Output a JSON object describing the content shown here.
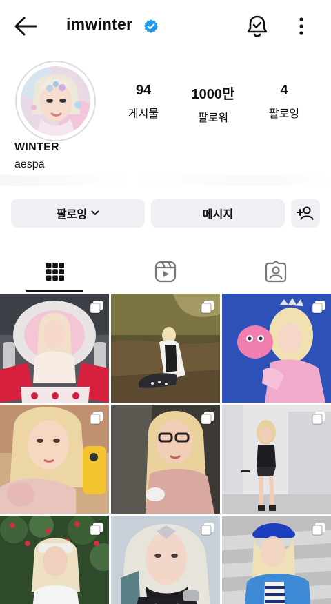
{
  "header": {
    "username": "imwinter",
    "back_icon": "arrow-left-icon",
    "verified_icon": "verified-badge-icon",
    "verified_color": "#1d9bf0",
    "bell_icon": "bell-check-icon",
    "more_icon": "more-vertical-icon"
  },
  "profile": {
    "display_name": "WINTER",
    "bio": "aespa",
    "stats": [
      {
        "value": "94",
        "label": "게시물"
      },
      {
        "value": "1000만",
        "label": "팔로워"
      },
      {
        "value": "4",
        "label": "팔로잉"
      }
    ]
  },
  "actions": {
    "following_label": "팔로잉",
    "message_label": "메시지",
    "add_icon": "add-person-icon",
    "chevron_icon": "chevron-down-icon"
  },
  "tabs": [
    {
      "name": "grid",
      "icon": "grid-icon",
      "active": true
    },
    {
      "name": "reels",
      "icon": "reels-icon",
      "active": false
    },
    {
      "name": "tagged",
      "icon": "tagged-person-icon",
      "active": false
    }
  ],
  "posts": [
    {
      "multi": true
    },
    {
      "multi": true
    },
    {
      "multi": true
    },
    {
      "multi": true
    },
    {
      "multi": true
    },
    {
      "multi": true
    },
    {
      "multi": true
    },
    {
      "multi": true
    },
    {
      "multi": true
    }
  ],
  "colors": {
    "button_bg": "#eef0f3",
    "text": "#111111"
  }
}
